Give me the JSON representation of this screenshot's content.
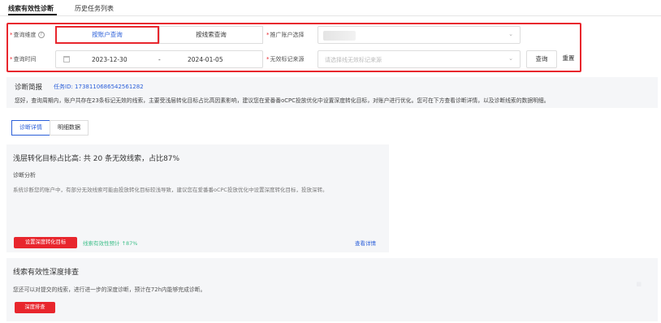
{
  "nav": {
    "tab_diagnosis": "线索有效性诊断",
    "tab_history": "历史任务列表"
  },
  "filter": {
    "query_dimension_label": "查询维度",
    "by_account": "按账户查询",
    "by_clue": "按线索查询",
    "account_label": "推广账户选择",
    "time_label": "查询时间",
    "start_date": "2023-12-30",
    "date_sep": "-",
    "end_date": "2024-01-05",
    "source_label": "无效标记来源",
    "source_placeholder": "请选择线无效标记来源",
    "query_button": "查询",
    "reset_button": "重置"
  },
  "brief": {
    "title": "诊断简报",
    "task_id": "任务ID: 1738110686542561282",
    "text": "您好，查询周期内，账户共存在23条标记无效的线索，主要受浅层转化目标占比高因素影响，建议您在爱番番oCPC投放优化中设置深度转化目标，对账户进行优化。您可在下方查看诊断详情，以及诊断线索的数据明细。"
  },
  "subtabs": {
    "details": "诊断详情",
    "data": "明细数据"
  },
  "card1": {
    "heading": "浅层转化目标占比高: 共 20 条无效线索，占比87%",
    "analysis_label": "诊断分析",
    "analysis_text": "系统诊断您的账户中，有部分无效线索可能由投放转化目标较浅导致，建议您在爱番番oCPC投放优化中设置深度转化目标，投放深转。",
    "action_button": "设置深度转化目标",
    "forecast": "线索有效性预计 ↑87%",
    "detail_link": "查看详情"
  },
  "card2": {
    "heading": "线索有效性深度排查",
    "text": "您还可以对提交的线索，进行进一步的深度诊断，预计在72h内能够完成诊断。",
    "action_button": "深度排查"
  },
  "colors": {
    "accent_red": "#e8262d",
    "link_blue": "#2b5fd9",
    "success_green": "#3fbf8a",
    "panel_bg": "#f5f6f8"
  }
}
